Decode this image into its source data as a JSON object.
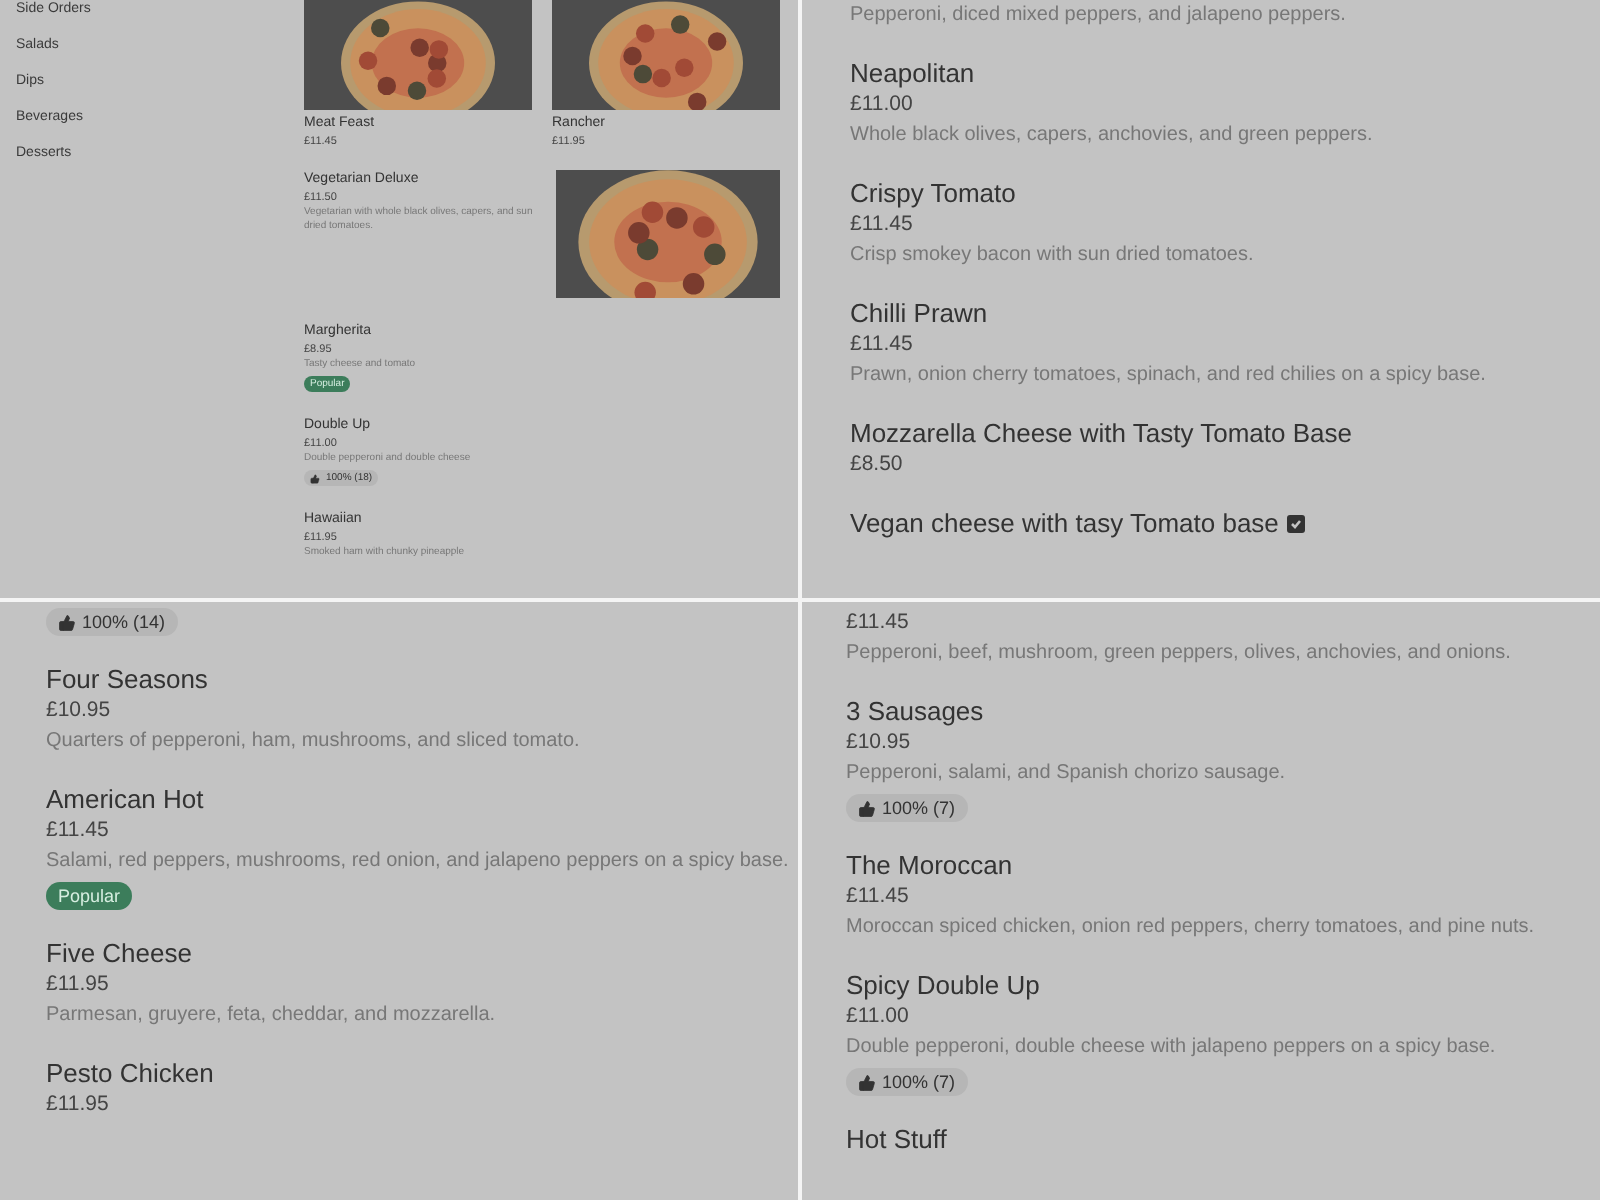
{
  "panels": [
    {
      "kind": "shop",
      "categories": [
        "Side Orders",
        "Salads",
        "Dips",
        "Beverages",
        "Desserts"
      ],
      "items": [
        {
          "kind": "tile",
          "name": "Meat Feast",
          "price": "£11.45"
        },
        {
          "kind": "tile",
          "name": "Rancher",
          "price": "£11.95"
        },
        {
          "kind": "row",
          "name": "Vegetarian Deluxe",
          "price": "£11.50",
          "description": "Vegetarian with whole black olives, capers, and sun dried tomatoes.",
          "picture": true
        },
        {
          "kind": "row",
          "name": "Margherita",
          "price": "£8.95",
          "description": "Tasty cheese and tomato",
          "badge": {
            "kind": "popular",
            "text": "Popular"
          }
        },
        {
          "kind": "row",
          "name": "Double Up",
          "price": "£11.00",
          "description": "Double pepperoni and double cheese",
          "badge": {
            "kind": "rating",
            "text": "100% (18)"
          }
        },
        {
          "kind": "row",
          "name": "Hawaiian",
          "price": "£11.95",
          "description": "Smoked ham with chunky pineapple"
        }
      ]
    },
    {
      "kind": "list",
      "items": [
        {
          "description": "Pepperoni, diced mixed peppers, and jalapeno peppers."
        },
        {
          "name": "Neapolitan",
          "price": "£11.00",
          "description": "Whole black olives, capers, anchovies, and green peppers."
        },
        {
          "name": "Crispy Tomato",
          "price": "£11.45",
          "description": "Crisp smokey bacon with sun dried tomatoes."
        },
        {
          "name": "Chilli Prawn",
          "price": "£11.45",
          "description": "Prawn, onion cherry tomatoes, spinach, and red chilies on a spicy base."
        },
        {
          "name": "Mozzarella Cheese with Tasty Tomato Base",
          "price": "£8.50"
        },
        {
          "name": "Vegan cheese with tasy Tomato base",
          "vegan": true
        }
      ]
    },
    {
      "kind": "list",
      "items": [
        {
          "badge": {
            "kind": "rating",
            "text": "100% (14)"
          }
        },
        {
          "name": "Four Seasons",
          "price": "£10.95",
          "description": "Quarters of pepperoni, ham, mushrooms, and sliced tomato."
        },
        {
          "name": "American Hot",
          "price": "£11.45",
          "description": "Salami, red peppers, mushrooms, red onion, and jalapeno peppers on a spicy base.",
          "badge": {
            "kind": "popular",
            "text": "Popular"
          }
        },
        {
          "name": "Five Cheese",
          "price": "£11.95",
          "description": "Parmesan, gruyere, feta, cheddar, and mozzarella."
        },
        {
          "name": "Pesto Chicken",
          "price": "£11.95"
        }
      ]
    },
    {
      "kind": "list",
      "items": [
        {
          "price": "£11.45",
          "description": "Pepperoni, beef, mushroom, green peppers, olives, anchovies, and onions."
        },
        {
          "name": "3 Sausages",
          "price": "£10.95",
          "description": "Pepperoni, salami, and Spanish chorizo sausage.",
          "badge": {
            "kind": "rating",
            "text": "100% (7)"
          }
        },
        {
          "name": "The Moroccan",
          "price": "£11.45",
          "description": "Moroccan spiced chicken, onion red peppers, cherry tomatoes, and pine nuts."
        },
        {
          "name": "Spicy Double Up",
          "price": "£11.00",
          "description": "Double pepperoni, double cheese with jalapeno peppers on a spicy base.",
          "badge": {
            "kind": "rating",
            "text": "100% (7)"
          }
        },
        {
          "name": "Hot Stuff"
        }
      ]
    }
  ]
}
